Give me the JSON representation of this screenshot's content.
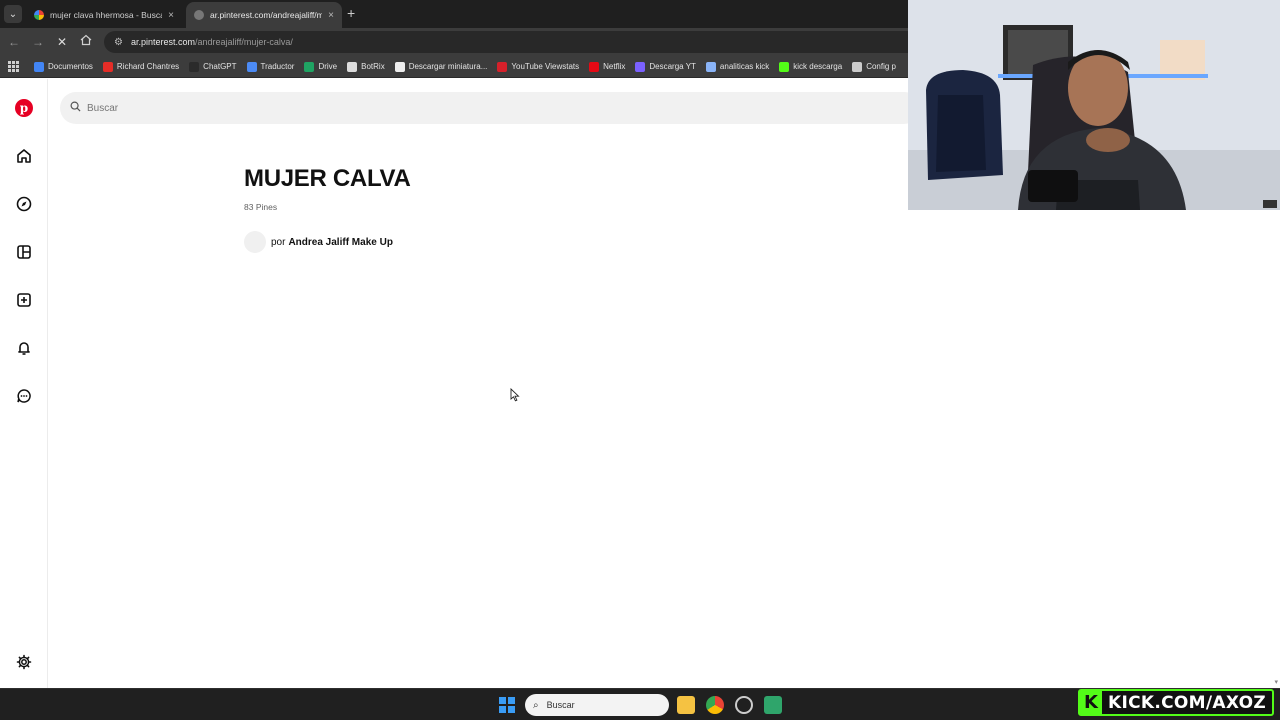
{
  "browser": {
    "tabs": [
      {
        "title": "mujer clava hhermosa - Buscar",
        "active": false
      },
      {
        "title": "ar.pinterest.com/andreajaliff/m",
        "active": true
      }
    ],
    "new_tab_symbol": "+",
    "close_symbol": "×",
    "url_host": "ar.pinterest.com",
    "url_path": "/andreajaliff/mujer-calva/",
    "bookmarks": [
      {
        "label": "Documentos",
        "icon": "docs-icon",
        "color": "#4285f4"
      },
      {
        "label": "Richard Chantres",
        "icon": "tiktok-icon",
        "color": "#e52d27"
      },
      {
        "label": "ChatGPT",
        "icon": "chatgpt-icon",
        "color": "#2b2b2b"
      },
      {
        "label": "Traductor",
        "icon": "translate-icon",
        "color": "#4c8bf5"
      },
      {
        "label": "Drive",
        "icon": "drive-icon",
        "color": "#1fa463"
      },
      {
        "label": "BotRix",
        "icon": "botrix-icon",
        "color": "#dddddd"
      },
      {
        "label": "Descargar miniatura...",
        "icon": "page-icon",
        "color": "#eeeeee"
      },
      {
        "label": "YouTube Viewstats",
        "icon": "viewstats-icon",
        "color": "#d6202a"
      },
      {
        "label": "Netflix",
        "icon": "netflix-icon",
        "color": "#e50914"
      },
      {
        "label": "Descarga YT",
        "icon": "download-icon",
        "color": "#7b61ff"
      },
      {
        "label": "analiticas kick",
        "icon": "analytics-icon",
        "color": "#8ab4f8"
      },
      {
        "label": "kick descarga",
        "icon": "kick-download-icon",
        "color": "#53fc18"
      },
      {
        "label": "Config p",
        "icon": "gear-icon",
        "color": "#cccccc"
      }
    ]
  },
  "pinterest": {
    "brand_color": "#e60023",
    "search_placeholder": "Buscar",
    "board": {
      "title": "MUJER CALVA",
      "pin_count": "83 Pines",
      "owner_prefix": "por",
      "owner_name": "Andrea Jaliff Make Up"
    }
  },
  "taskbar": {
    "search_label": "Buscar"
  },
  "overlay": {
    "watermark_letter": "K",
    "watermark_text": "KICK.COM/AXOZ",
    "accent_color": "#53fc18"
  }
}
